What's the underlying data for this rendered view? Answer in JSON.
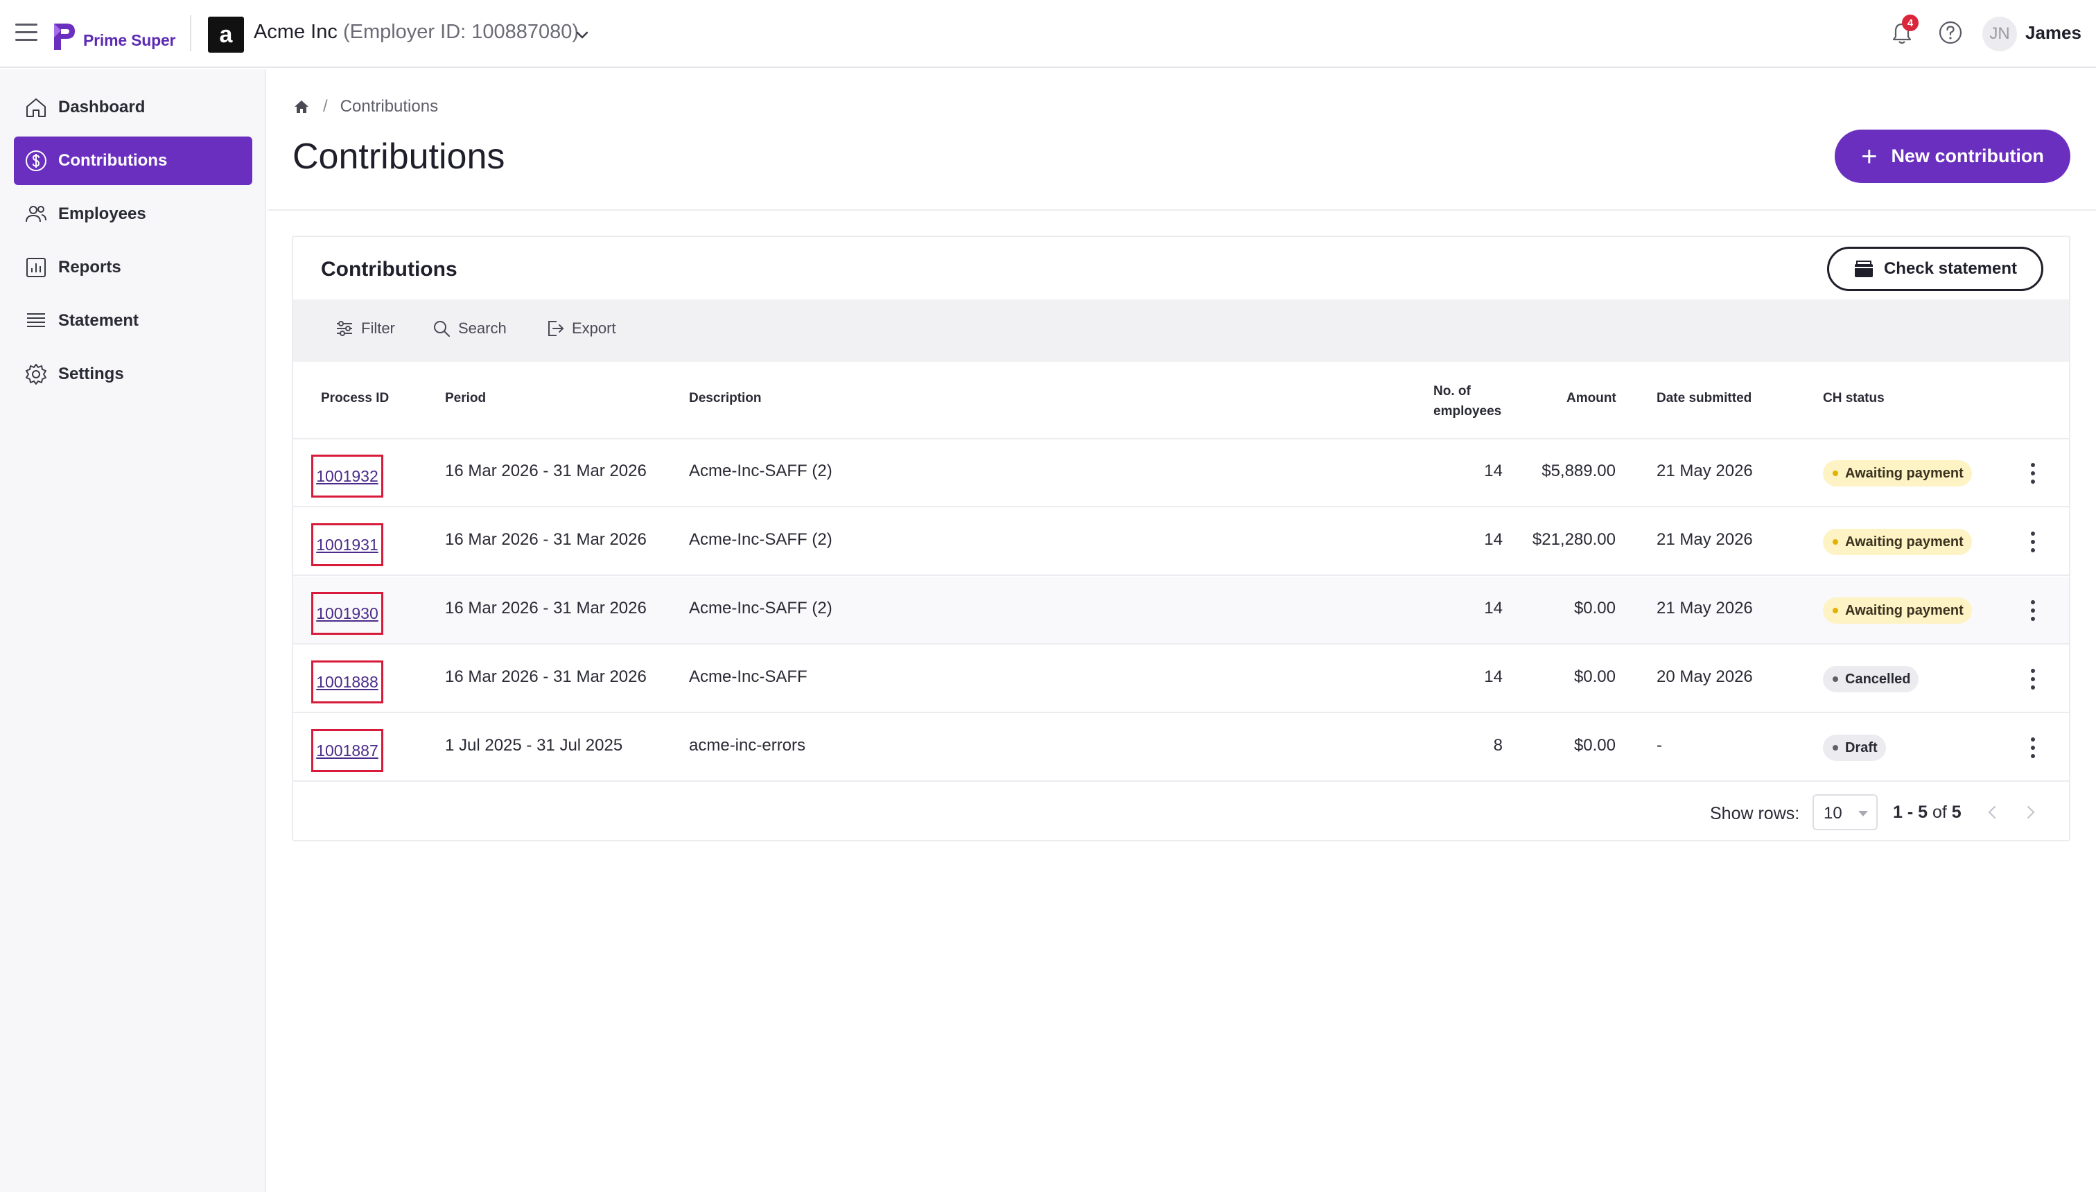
{
  "app": {
    "brand": "Prime Super"
  },
  "org": {
    "avatar_letter": "a",
    "name": "Acme Inc",
    "employer_id": "(Employer ID: 100887080)"
  },
  "notifications": {
    "count": "4"
  },
  "user": {
    "initials": "JN",
    "name": "James"
  },
  "sidebar": {
    "items": [
      {
        "label": "Dashboard",
        "icon": "home-icon",
        "active": false
      },
      {
        "label": "Contributions",
        "icon": "dollar-circle-icon",
        "active": true
      },
      {
        "label": "Employees",
        "icon": "people-icon",
        "active": false
      },
      {
        "label": "Reports",
        "icon": "bar-chart-icon",
        "active": false
      },
      {
        "label": "Statement",
        "icon": "list-icon",
        "active": false
      },
      {
        "label": "Settings",
        "icon": "gear-icon",
        "active": false
      }
    ]
  },
  "breadcrumb": {
    "current": "Contributions",
    "separator": "/"
  },
  "page": {
    "title": "Contributions",
    "new_button": "New contribution",
    "new_button_icon": "+"
  },
  "card": {
    "title": "Contributions",
    "check_statement": "Check statement",
    "toolbar": {
      "filter": "Filter",
      "search": "Search",
      "export": "Export"
    },
    "columns": {
      "process_id": "Process ID",
      "period": "Period",
      "description": "Description",
      "employees_line1": "No. of",
      "employees_line2": "employees",
      "amount": "Amount",
      "date_submitted": "Date submitted",
      "ch_status": "CH status"
    },
    "rows": [
      {
        "process_id": "1001932",
        "period": "16 Mar 2026 - 31 Mar 2026",
        "description": "Acme-Inc-SAFF (2)",
        "employees": "14",
        "amount": "$5,889.00",
        "date_submitted": "21 May 2026",
        "status": "Awaiting payment"
      },
      {
        "process_id": "1001931",
        "period": "16 Mar 2026 - 31 Mar 2026",
        "description": "Acme-Inc-SAFF (2)",
        "employees": "14",
        "amount": "$21,280.00",
        "date_submitted": "21 May 2026",
        "status": "Awaiting payment"
      },
      {
        "process_id": "1001930",
        "period": "16 Mar 2026 - 31 Mar 2026",
        "description": "Acme-Inc-SAFF (2)",
        "employees": "14",
        "amount": "$0.00",
        "date_submitted": "21 May 2026",
        "status": "Awaiting payment"
      },
      {
        "process_id": "1001888",
        "period": "16 Mar 2026 - 31 Mar 2026",
        "description": "Acme-Inc-SAFF",
        "employees": "14",
        "amount": "$0.00",
        "date_submitted": "20 May 2026",
        "status": "Cancelled"
      },
      {
        "process_id": "1001887",
        "period": "1 Jul 2025 - 31 Jul 2025",
        "description": "acme-inc-errors",
        "employees": "8",
        "amount": "$0.00",
        "date_submitted": "-",
        "status": "Draft"
      }
    ],
    "pagination": {
      "show_rows_label": "Show rows:",
      "rows_per_page": "10",
      "range": "1 - 5",
      "of": "of",
      "total": "5"
    }
  },
  "colors": {
    "brand": "#6a2fbf",
    "highlight_border": "#d81b3a",
    "awaiting_bg": "#fdf3c4",
    "badge_red": "#d9263b"
  }
}
